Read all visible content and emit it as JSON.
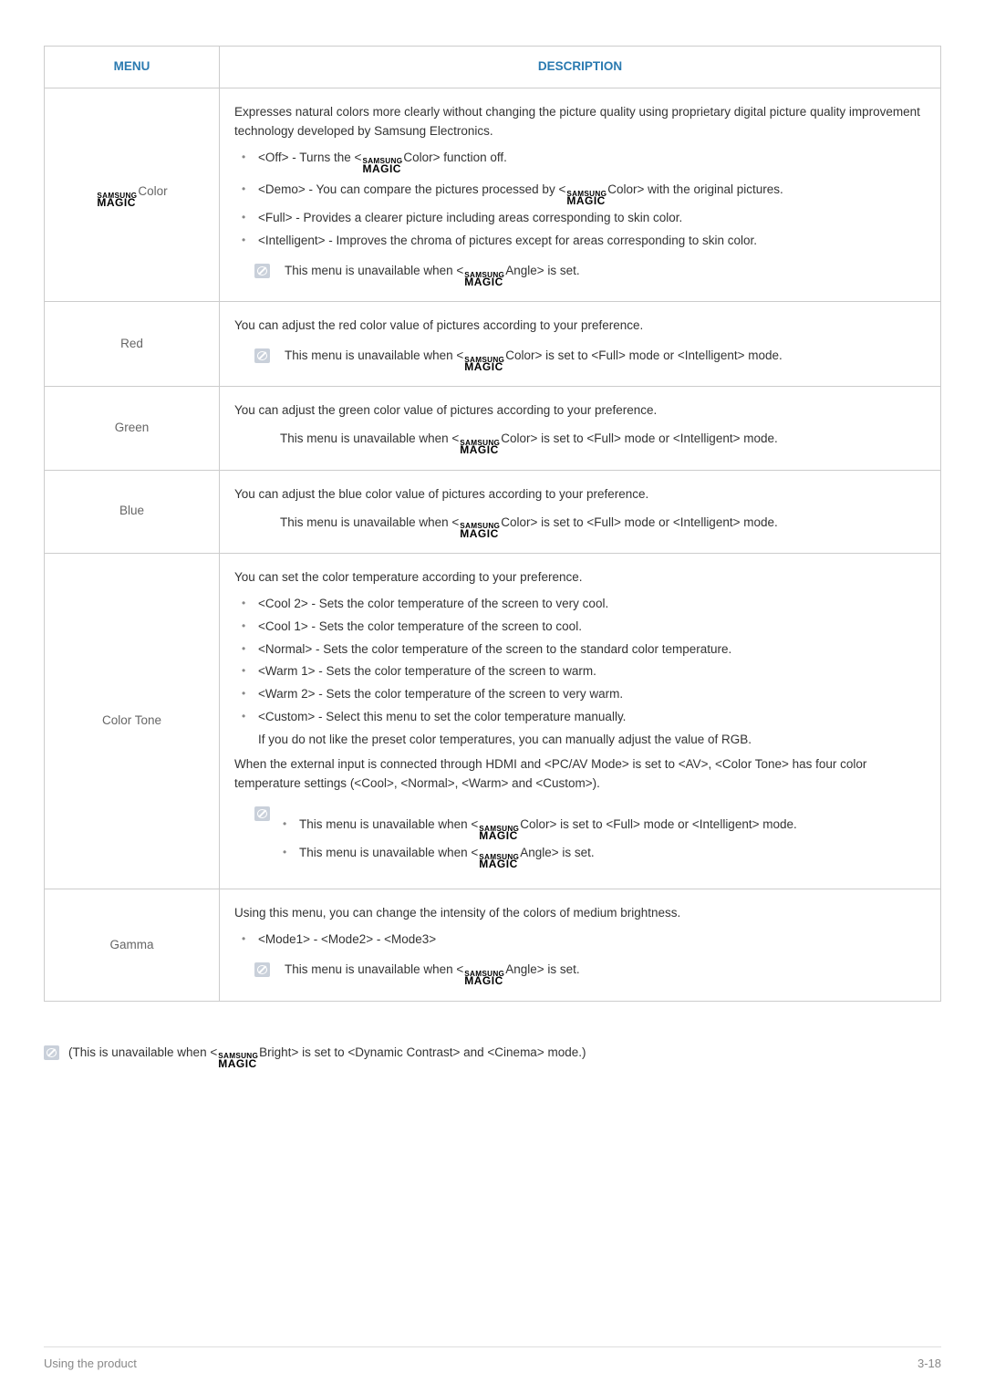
{
  "table": {
    "headers": {
      "menu": "MENU",
      "description": "DESCRIPTION"
    },
    "rows": [
      {
        "menu_label_prefix": "",
        "menu_uses_logo": true,
        "menu_label_suffix": "Color",
        "intro": "Expresses natural colors more clearly without changing the picture quality using proprietary digital picture quality improvement technology developed by Samsung Electronics.",
        "bullets_a": [
          {
            "pre": "<Off> - Turns the <",
            "post": "Color> function off."
          }
        ],
        "bullets_b": [
          {
            "pre": "<Demo> - You can compare the pictures processed by <",
            "post": "Color> with the original pictures."
          },
          {
            "text": "<Full> - Provides a clearer picture including areas corresponding to skin color."
          },
          {
            "text": "<Intelligent> - Improves the chroma of pictures except for areas corresponding to skin color."
          }
        ],
        "note": {
          "pre": "This menu is unavailable when <",
          "post": "Angle> is set."
        }
      },
      {
        "menu_label": "Red",
        "intro": "You can adjust the red color value of pictures according to your preference.",
        "note": {
          "pre": "This menu is unavailable when <",
          "post": "Color> is set to <Full> mode or <Intelligent> mode."
        }
      },
      {
        "menu_label": "Green",
        "intro": "You can adjust the green color value of pictures according to your preference.",
        "note_plain": {
          "pre": "This menu is unavailable when <",
          "post": "Color> is set to <Full> mode or <Intelligent> mode."
        }
      },
      {
        "menu_label": "Blue",
        "intro": "You can adjust the blue color value of pictures according to your preference.",
        "note_plain": {
          "pre": "This menu is unavailable when <",
          "post": "Color> is set to <Full> mode or <Intelligent> mode."
        }
      },
      {
        "menu_label": "Color Tone",
        "intro": "You can set the color temperature according to your preference.",
        "bullets": [
          "<Cool 2> - Sets the color temperature of the screen to very cool.",
          "<Cool 1> - Sets the color temperature of the screen to cool.",
          "<Normal> - Sets the color temperature of the screen to the standard color temperature.",
          "<Warm 1> - Sets the color temperature of the screen to warm.",
          "<Warm 2> - Sets the color temperature of the screen to very warm.",
          "<Custom> - Select this menu to set the color temperature manually."
        ],
        "custom_sub": "If you do not like the preset color temperatures, you can manually adjust the value of RGB.",
        "para": "When the external input is connected through HDMI and <PC/AV Mode> is set to <AV>, <Color Tone> has four color temperature settings (<Cool>, <Normal>, <Warm> and <Custom>).",
        "sub_notes": [
          {
            "pre": "This menu is unavailable when <",
            "post": "Color> is set to <Full> mode or <Intelligent> mode."
          },
          {
            "pre": "This menu is unavailable when <",
            "post": "Angle> is set."
          }
        ]
      },
      {
        "menu_label": "Gamma",
        "intro": "Using this menu, you can change the intensity of the colors of medium brightness.",
        "bullets": [
          "<Mode1> - <Mode2> - <Mode3>"
        ],
        "note": {
          "pre": "This menu is unavailable when <",
          "post": "Angle> is set."
        }
      }
    ]
  },
  "bottom_note": {
    "pre": "(This is unavailable when <",
    "post": "Bright> is set to <Dynamic Contrast> and <Cinema> mode.)"
  },
  "logo": {
    "line1": "SAMSUNG",
    "line2": "MAGIC"
  },
  "footer": {
    "left": "Using the product",
    "right": "3-18"
  }
}
